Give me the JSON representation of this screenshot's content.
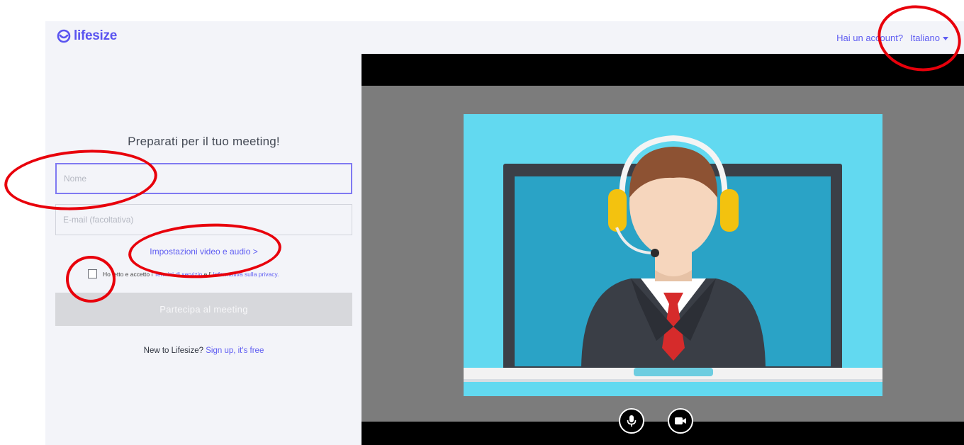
{
  "brand": {
    "name": "lifesize",
    "color": "#5a54f0"
  },
  "topnav": {
    "account_link": "Hai un account?",
    "language": "Italiano"
  },
  "form": {
    "title": "Preparati per il tuo meeting!",
    "name_placeholder": "Nome",
    "email_placeholder": "E-mail (facoltativa)",
    "settings_link": "Impostazioni video e audio >",
    "consent_prefix": "Ho letto e accetto i",
    "consent_terms": "Termini di servizio",
    "consent_middle": "e l'",
    "consent_privacy": "Informativa sulla privacy.",
    "join_button": "Partecipa al meeting",
    "signup_prefix": "New to Lifesize?",
    "signup_link": "Sign up, it's free"
  },
  "preview": {
    "mic_icon": "microphone-icon",
    "camera_icon": "video-camera-icon"
  },
  "colors": {
    "accent": "#5e5cf2",
    "annotation": "#e8000b",
    "video_background": "#62d9f0"
  }
}
